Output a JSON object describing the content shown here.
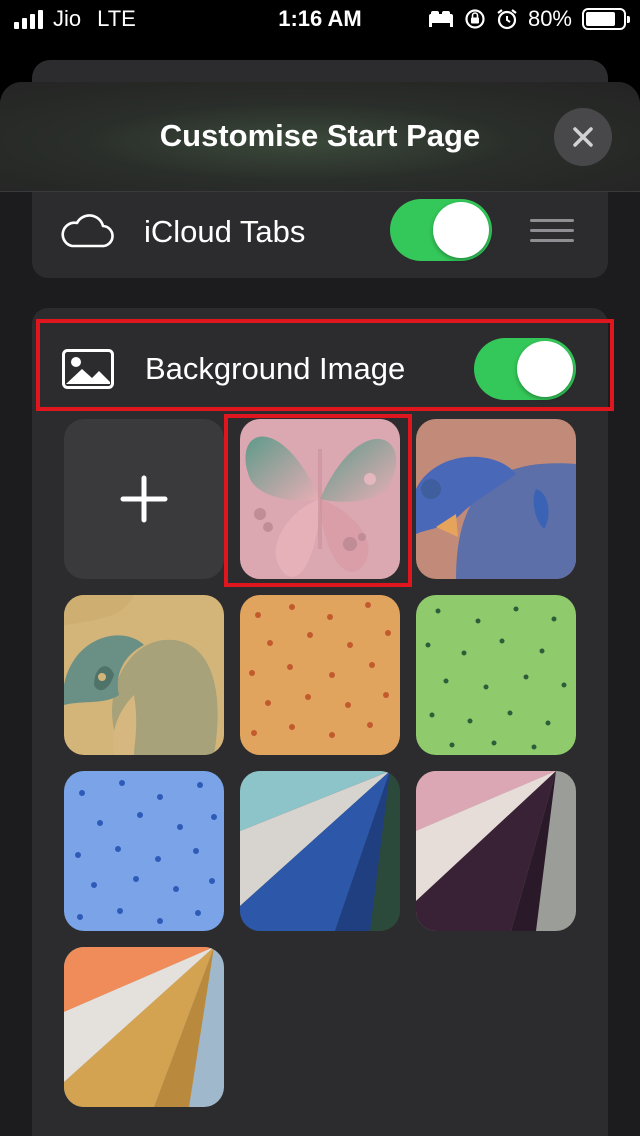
{
  "status_bar": {
    "carrier": "Jio",
    "network": "LTE",
    "time": "1:16 AM",
    "battery": "80%",
    "battery_level": 0.8,
    "icons": [
      "signal-icon",
      "bed-icon",
      "orientation-lock-icon",
      "alarm-icon",
      "battery-icon"
    ]
  },
  "sheet": {
    "title": "Customise Start Page",
    "close_icon": "close-icon"
  },
  "rows": {
    "icloud_tabs": {
      "label": "iCloud Tabs",
      "enabled": true,
      "icon": "cloud-icon"
    },
    "background_image": {
      "label": "Background Image",
      "enabled": true,
      "icon": "photo-icon"
    }
  },
  "backgrounds": {
    "add_icon": "plus-icon",
    "selected_index": 1,
    "items": [
      {
        "name": "add-custom"
      },
      {
        "name": "butterfly"
      },
      {
        "name": "bear"
      },
      {
        "name": "parrot"
      },
      {
        "name": "orange-pattern"
      },
      {
        "name": "green-pattern"
      },
      {
        "name": "blue-pattern"
      },
      {
        "name": "teal-blue-folds"
      },
      {
        "name": "pink-plum-folds"
      },
      {
        "name": "orange-gold-folds"
      }
    ]
  },
  "colors": {
    "toggle_on": "#34c759",
    "highlight": "#e0161f",
    "sheet_bg": "#1c1c1e",
    "card_bg": "#2c2c2e"
  }
}
